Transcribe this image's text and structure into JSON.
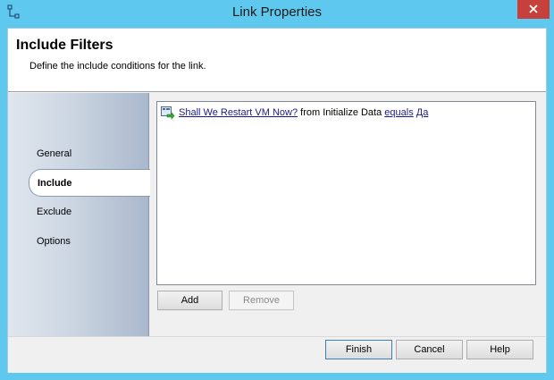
{
  "window": {
    "title": "Link Properties"
  },
  "header": {
    "title": "Include Filters",
    "subtitle": "Define the include conditions for the link."
  },
  "sidebar": {
    "items": [
      {
        "label": "General",
        "active": false
      },
      {
        "label": "Include",
        "active": true
      },
      {
        "label": "Exclude",
        "active": false
      },
      {
        "label": "Options",
        "active": false
      }
    ]
  },
  "filters": [
    {
      "parameter": "Shall We Restart VM Now?",
      "source_text": " from Initialize Data ",
      "operator": "equals",
      "space": " ",
      "value": "Да"
    }
  ],
  "list_buttons": {
    "add": "Add",
    "remove": "Remove"
  },
  "footer_buttons": {
    "finish": "Finish",
    "cancel": "Cancel",
    "help": "Help"
  },
  "colors": {
    "titlebar": "#5ec8ee",
    "close_button": "#c7413c",
    "link_text": "#1a1a8a"
  }
}
